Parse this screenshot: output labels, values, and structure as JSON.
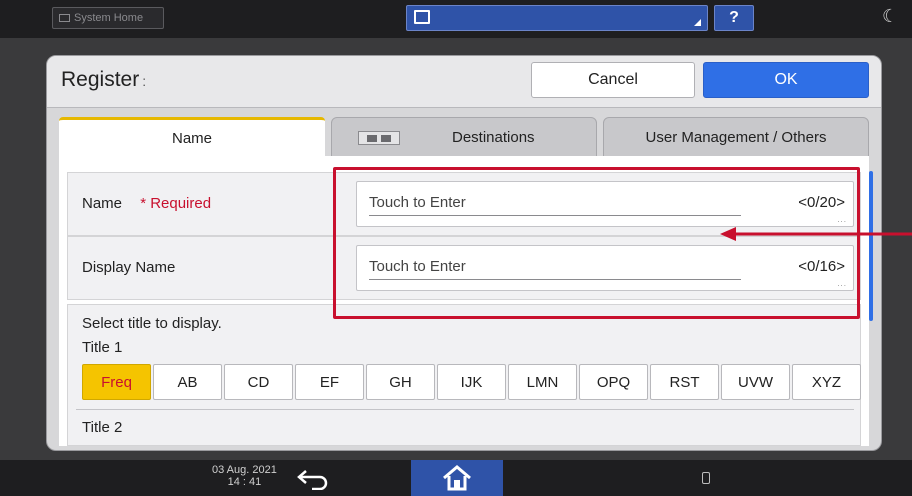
{
  "topbar": {
    "system_home_label": "System Home",
    "help_label": "?"
  },
  "dialog": {
    "title": "Register",
    "title_suffix": ":",
    "cancel_label": "Cancel",
    "ok_label": "OK"
  },
  "tabs": [
    {
      "label": "Name",
      "active": true
    },
    {
      "label": "Destinations",
      "active": false
    },
    {
      "label": "User Management / Others",
      "active": false
    }
  ],
  "form": {
    "name": {
      "label": "Name",
      "required_label": "* Required",
      "placeholder": "Touch to Enter",
      "counter": "<0/20>"
    },
    "display_name": {
      "label": "Display Name",
      "placeholder": "Touch to Enter",
      "counter": "<0/16>"
    }
  },
  "title_section": {
    "instruction": "Select title to display.",
    "title1_label": "Title 1",
    "title2_label": "Title 2",
    "options": [
      "Freq",
      "AB",
      "CD",
      "EF",
      "GH",
      "IJK",
      "LMN",
      "OPQ",
      "RST",
      "UVW",
      "XYZ"
    ],
    "selected": "Freq"
  },
  "bottombar": {
    "date": "03 Aug. 2021",
    "time": "14 : 41"
  },
  "colors": {
    "accent_blue": "#2f6fe6",
    "active_tab_border": "#e6b800",
    "selected_option_bg": "#f5c400",
    "required_red": "#c8102e",
    "highlight_red": "#c8102e"
  }
}
